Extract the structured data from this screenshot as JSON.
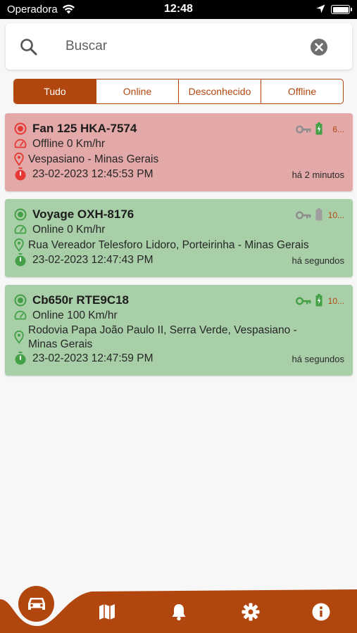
{
  "status_bar": {
    "carrier": "Operadora",
    "time": "12:48"
  },
  "search": {
    "placeholder": "Buscar",
    "value": ""
  },
  "filters": {
    "all": "Tudo",
    "online": "Online",
    "unknown": "Desconhecido",
    "offline": "Offline",
    "active": "Tudo"
  },
  "colors": {
    "accent": "#b2460f",
    "offline_card": "#e3a8a8",
    "online_card": "#a9cfa9",
    "offline_icon": "#e53935",
    "online_icon": "#43a047"
  },
  "vehicles": [
    {
      "name": "Fan 125 HKA-7574",
      "status_line": "Offline 0 Km/hr",
      "address": "Vespasiano - Minas Gerais",
      "datetime": "23-02-2023 12:45:53 PM",
      "ago": "há 2 minutos",
      "battery_text": "6...",
      "state": "offline",
      "ignition": "off",
      "battery_level": "full"
    },
    {
      "name": "Voyage OXH-8176",
      "status_line": "Online 0 Km/hr",
      "address": "Rua Vereador Telesforo Lidoro, Porteirinha - Minas Gerais",
      "datetime": "23-02-2023 12:47:43 PM",
      "ago": "há segundos",
      "battery_text": "10...",
      "state": "online",
      "ignition": "off",
      "battery_level": "unknown"
    },
    {
      "name": "Cb650r RTE9C18",
      "status_line": "Online 100 Km/hr",
      "address_line1": "Rodovia Papa João Paulo II, Serra Verde, Vespasiano -",
      "address_line2": "Minas Gerais",
      "datetime": "23-02-2023 12:47:59 PM",
      "ago": "há segundos",
      "battery_text": "10...",
      "state": "online",
      "ignition": "on",
      "battery_level": "full"
    }
  ],
  "bottom_nav": {
    "items": [
      "car-icon",
      "map-icon",
      "bell-icon",
      "gear-icon",
      "info-icon"
    ],
    "active": "car-icon"
  }
}
